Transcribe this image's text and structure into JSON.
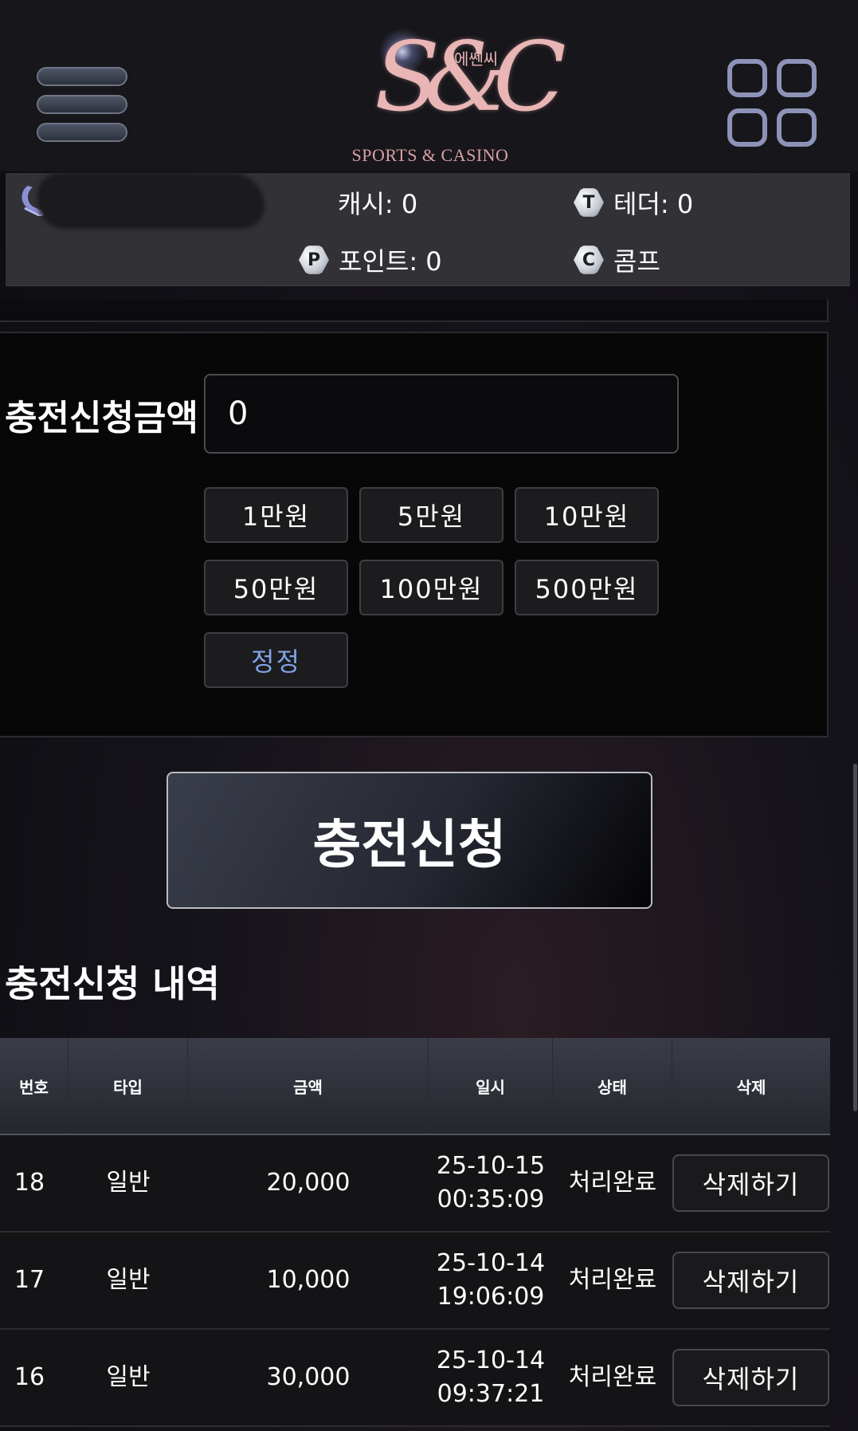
{
  "header": {
    "menu_icon": "hamburger-menu-icon",
    "logo": {
      "monogram": "S&C",
      "korean": "에쎈씨",
      "subtitle": "SPORTS & CASINO"
    },
    "apps_icon": "grid-apps-icon"
  },
  "account": {
    "cash_label": "캐시: 0",
    "tether_badge": "T",
    "tether_label": "테더: 0",
    "point_badge": "P",
    "point_label": "포인트: 0",
    "comp_badge": "C",
    "comp_label": "콤프"
  },
  "deposit": {
    "amount_label": "충전신청금액",
    "amount_value": "0",
    "quick_amounts": [
      "1만원",
      "5만원",
      "10만원",
      "50만원",
      "100만원",
      "500만원"
    ],
    "reset_label": "정정",
    "submit_label": "충전신청"
  },
  "history": {
    "title": "충전신청 내역",
    "columns": [
      "번호",
      "타입",
      "금액",
      "일시",
      "상태",
      "삭제"
    ],
    "rows": [
      {
        "no": "18",
        "type": "일반",
        "amount": "20,000",
        "date": "25-10-15",
        "time": "00:35:09",
        "status": "처리완료",
        "delete_label": "삭제하기"
      },
      {
        "no": "17",
        "type": "일반",
        "amount": "10,000",
        "date": "25-10-14",
        "time": "19:06:09",
        "status": "처리완료",
        "delete_label": "삭제하기"
      },
      {
        "no": "16",
        "type": "일반",
        "amount": "30,000",
        "date": "25-10-14",
        "time": "09:37:21",
        "status": "처리완료",
        "delete_label": "삭제하기"
      }
    ]
  },
  "colors": {
    "accent_blue": "#7fa4e6",
    "logo_pink": "#e9b5b5",
    "icon_lavender": "#8d93b8"
  }
}
